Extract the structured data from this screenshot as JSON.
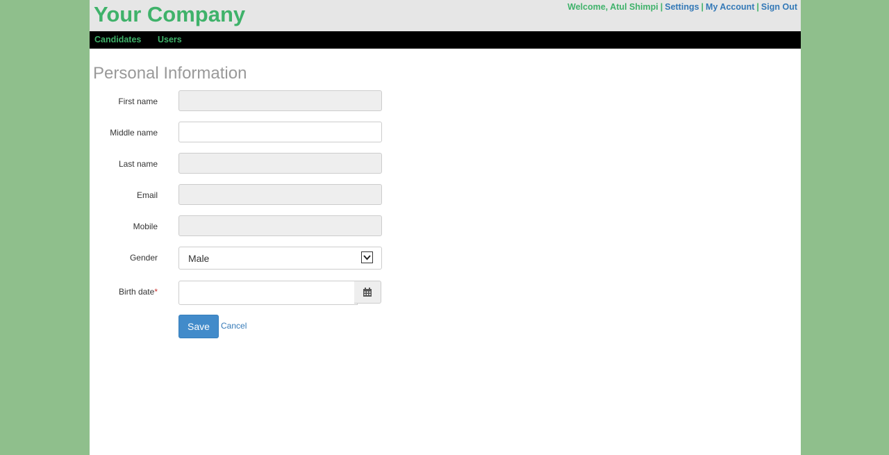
{
  "header": {
    "brand": "Your Company",
    "welcome": "Welcome, Atul Shimpi",
    "separator": "|",
    "links": [
      "Settings",
      "My Account",
      "Sign Out"
    ]
  },
  "nav": {
    "items": [
      "Candidates",
      "Users"
    ]
  },
  "form": {
    "title": "Personal Information",
    "fields": [
      {
        "label": "First name",
        "value": "",
        "disabled": true
      },
      {
        "label": "Middle name",
        "value": "",
        "disabled": false
      },
      {
        "label": "Last name",
        "value": "",
        "disabled": true
      },
      {
        "label": "Email",
        "value": "",
        "disabled": true
      },
      {
        "label": "Mobile",
        "value": "",
        "disabled": true
      }
    ],
    "gender": {
      "label": "Gender",
      "selected": "Male"
    },
    "birth_date": {
      "label": "Birth date",
      "required_mark": "*",
      "value": ""
    },
    "save_label": "Save",
    "cancel_label": "Cancel"
  },
  "icons": {
    "calendar": "calendar-icon",
    "dropdown": "chevron-down-icon"
  },
  "colors": {
    "brand": "#3fb26a",
    "link": "#3479b7",
    "primary_button": "#428bca",
    "background": "#8fbf8c"
  }
}
